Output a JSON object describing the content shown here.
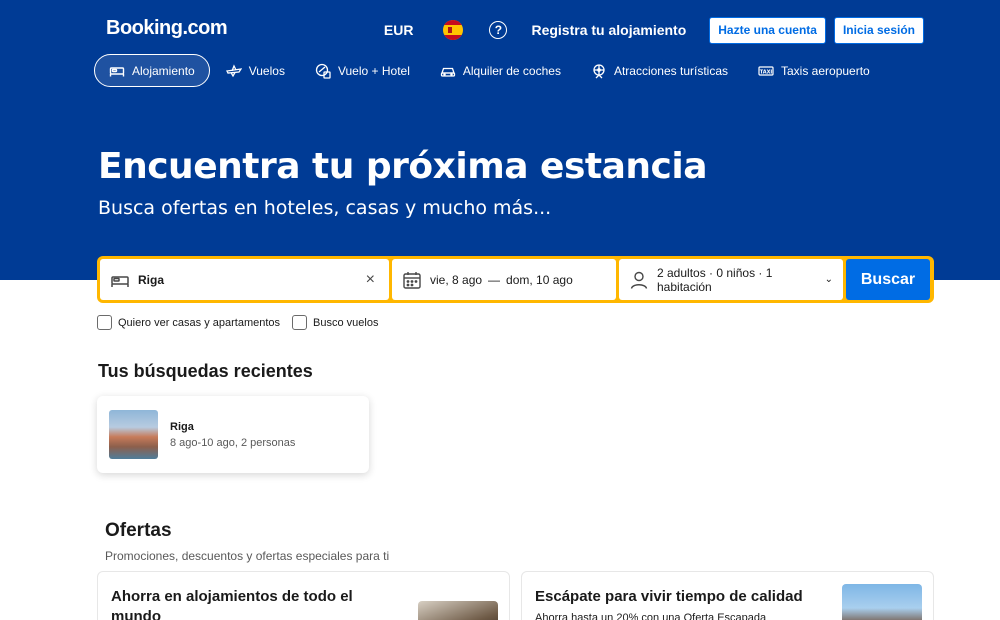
{
  "header": {
    "logo": "Booking.com",
    "currency": "EUR",
    "help_icon": "?",
    "register_property": "Registra tu alojamiento",
    "create_account": "Hazte una cuenta",
    "sign_in": "Inicia sesión"
  },
  "nav": {
    "items": [
      {
        "label": "Alojamiento",
        "icon": "bed-icon",
        "active": true
      },
      {
        "label": "Vuelos",
        "icon": "plane-icon"
      },
      {
        "label": "Vuelo + Hotel",
        "icon": "plane-hotel-icon"
      },
      {
        "label": "Alquiler de coches",
        "icon": "car-icon"
      },
      {
        "label": "Atracciones turísticas",
        "icon": "attractions-icon"
      },
      {
        "label": "Taxis aeropuerto",
        "icon": "taxi-icon"
      }
    ]
  },
  "hero": {
    "title": "Encuentra tu próxima estancia",
    "subtitle": "Busca ofertas en hoteles, casas y mucho más..."
  },
  "search": {
    "destination": "Riga",
    "clear_icon": "×",
    "checkin": "vie, 8 ago",
    "dash": "—",
    "checkout": "dom, 10 ago",
    "guests": "2 adultos · 0 niños · 1 habitación",
    "chevron": "⌄",
    "button": "Buscar"
  },
  "options": {
    "homes": "Quiero ver casas y apartamentos",
    "flights": "Busco vuelos"
  },
  "recent": {
    "title": "Tus búsquedas recientes",
    "items": [
      {
        "name": "Riga",
        "meta": "8 ago-10 ago, 2 personas"
      }
    ]
  },
  "offers": {
    "title": "Ofertas",
    "subtitle": "Promociones, descuentos y ofertas especiales para ti",
    "cards": [
      {
        "title": "Ahorra en alojamientos de todo el mundo",
        "desc": ""
      },
      {
        "title": "Escápate para vivir tiempo de calidad",
        "desc": "Ahorra hasta un 20% con una Oferta Escapada"
      }
    ]
  },
  "colors": {
    "brand_blue": "#003b95",
    "action_blue": "#006ce4",
    "search_yellow": "#ffb700"
  }
}
